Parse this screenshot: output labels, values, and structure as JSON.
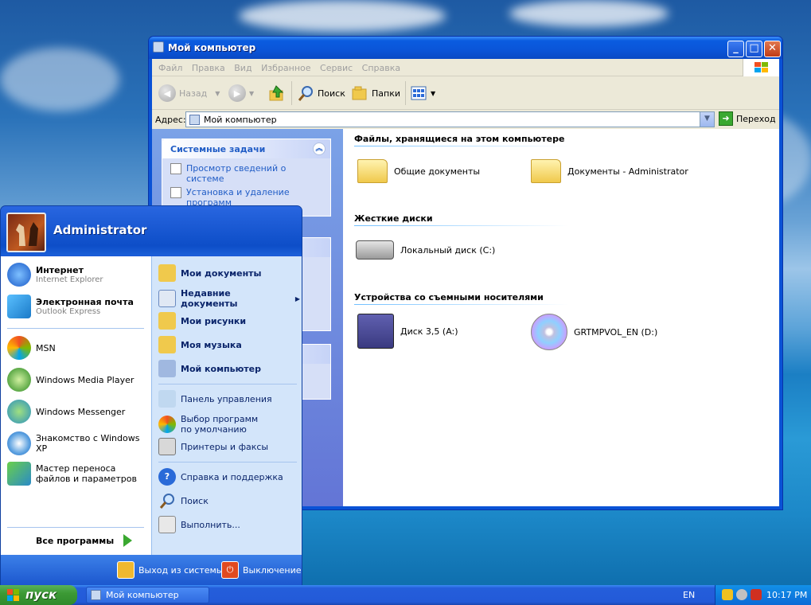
{
  "window": {
    "title": "Мой компьютер",
    "menu": [
      "Файл",
      "Правка",
      "Вид",
      "Избранное",
      "Сервис",
      "Справка"
    ],
    "toolbar": {
      "back": "Назад",
      "search": "Поиск",
      "folders": "Папки"
    },
    "address": {
      "label": "Адрес:",
      "value": "Мой компьютер",
      "go": "Переход"
    },
    "tasks_panel": {
      "title": "Системные задачи",
      "items": [
        "Просмотр сведений о системе",
        "Установка и удаление программ"
      ]
    },
    "groups": [
      {
        "title": "Файлы, хранящиеся на этом компьютере",
        "items": [
          "Общие документы",
          "Документы - Administrator"
        ]
      },
      {
        "title": "Жесткие диски",
        "items": [
          "Локальный диск (C:)"
        ]
      },
      {
        "title": "Устройства со съемными носителями",
        "items": [
          "Диск 3,5 (A:)",
          "GRTMPVOL_EN (D:)"
        ]
      }
    ]
  },
  "start_menu": {
    "user": "Administrator",
    "pinned": [
      {
        "title": "Интернет",
        "sub": "Internet Explorer",
        "icon": "ie-icon"
      },
      {
        "title": "Электронная почта",
        "sub": "Outlook Express",
        "icon": "outlook-icon"
      }
    ],
    "recent": [
      "MSN",
      "Windows Media Player",
      "Windows Messenger",
      "Знакомство с Windows XP",
      "Мастер переноса файлов и параметров"
    ],
    "all_programs": "Все программы",
    "places_bold": [
      "Мои документы",
      "Недавние документы",
      "Мои рисунки",
      "Моя музыка",
      "Мой компьютер"
    ],
    "places": [
      "Панель управления",
      "Выбор программ по умолчанию",
      "Принтеры и факсы"
    ],
    "help": [
      "Справка и поддержка",
      "Поиск",
      "Выполнить..."
    ],
    "logoff": "Выход из системы",
    "shutdown": "Выключение"
  },
  "taskbar": {
    "start": "пуск",
    "task": "Мой компьютер",
    "lang": "EN",
    "clock": "10:17 PM"
  }
}
